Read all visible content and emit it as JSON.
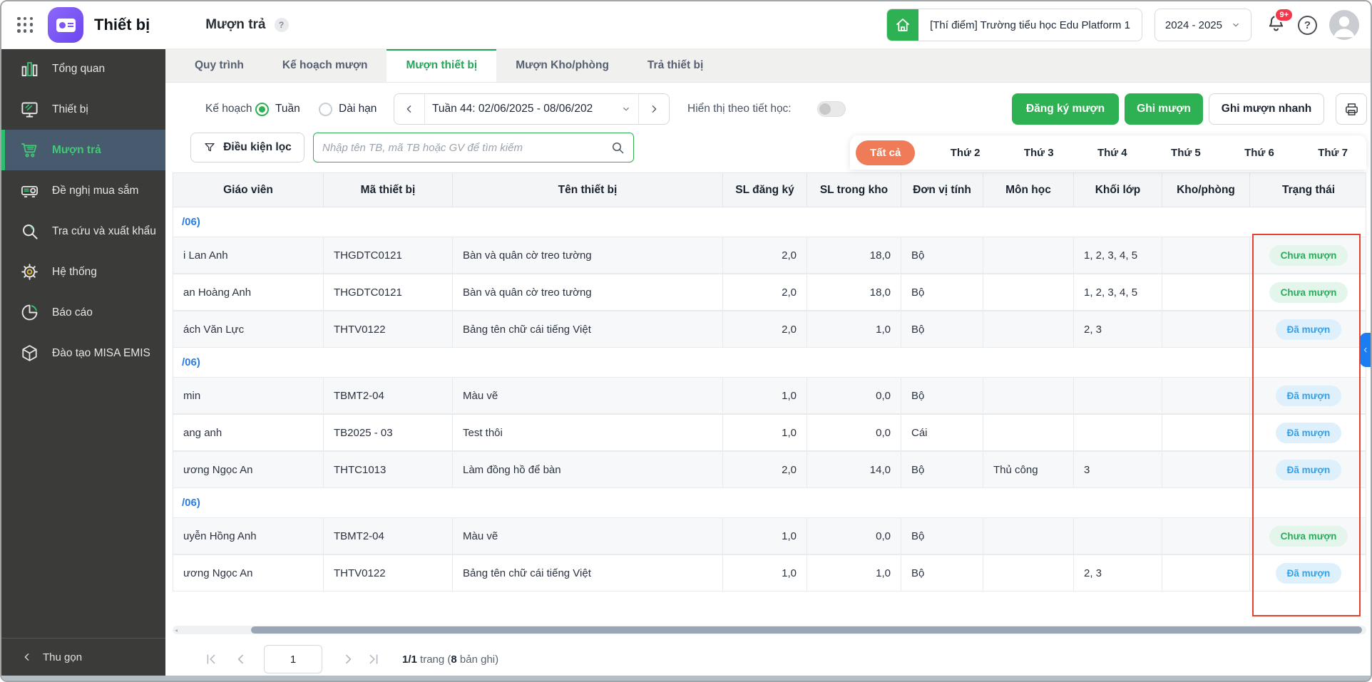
{
  "header": {
    "app_name": "Thiết bị",
    "page_title": "Mượn trả",
    "help_badge": "?",
    "school": "[Thí điểm] Trường tiểu học Edu Platform 1",
    "school_year": "2024 - 2025",
    "notification_count": "9+"
  },
  "sidebar": {
    "items": [
      {
        "id": "tong-quan",
        "label": "Tổng quan",
        "icon": "bar-chart-icon",
        "active": false
      },
      {
        "id": "thiet-bi",
        "label": "Thiết bị",
        "icon": "monitor-icon",
        "active": false
      },
      {
        "id": "muon-tra",
        "label": "Mượn trả",
        "icon": "cart-icon",
        "active": true
      },
      {
        "id": "de-nghi-mua-sam",
        "label": "Đề nghị mua sắm",
        "icon": "projector-icon",
        "active": false
      },
      {
        "id": "tra-cuu-va-xuat-khau",
        "label": "Tra cứu và xuất khẩu",
        "icon": "search-icon",
        "active": false
      },
      {
        "id": "he-thong",
        "label": "Hệ thống",
        "icon": "gear-icon",
        "active": false
      },
      {
        "id": "bao-cao",
        "label": "Báo cáo",
        "icon": "pie-chart-icon",
        "active": false
      },
      {
        "id": "dao-tao-misa-emis",
        "label": "Đào tạo MISA EMIS",
        "icon": "cube-icon",
        "active": false
      }
    ],
    "collapse_label": "Thu gọn"
  },
  "tabs": {
    "active_index": 2,
    "items": [
      {
        "id": "quy-trinh",
        "label": "Quy trình"
      },
      {
        "id": "ke-hoach-muon",
        "label": "Kế hoạch mượn"
      },
      {
        "id": "muon-thiet-bi",
        "label": "Mượn thiết bị"
      },
      {
        "id": "muon-kho-phong",
        "label": "Mượn Kho/phòng"
      },
      {
        "id": "tra-thiet-bi",
        "label": "Trả thiết bị"
      }
    ]
  },
  "controls": {
    "plan_label": "Kế hoạch",
    "radio_week": "Tuần",
    "radio_longterm": "Dài hạn",
    "week_selector": "Tuần 44: 02/06/2025 - 08/06/202",
    "toggle_label": "Hiển thị theo tiết học:",
    "toggle_state": "off",
    "register_button": "Đăng ký mượn",
    "record_button": "Ghi mượn",
    "quick_record_button": "Ghi mượn nhanh"
  },
  "filter": {
    "filter_button": "Điều kiện lọc",
    "search_placeholder": "Nhập tên TB, mã TB hoặc GV để tìm kiếm",
    "search_value": ""
  },
  "day_tabs": {
    "active_index": 0,
    "items": [
      {
        "id": "tat-ca",
        "label": "Tất cả"
      },
      {
        "id": "thu-2",
        "label": "Thứ 2"
      },
      {
        "id": "thu-3",
        "label": "Thứ 3"
      },
      {
        "id": "thu-4",
        "label": "Thứ 4"
      },
      {
        "id": "thu-5",
        "label": "Thứ 5"
      },
      {
        "id": "thu-6",
        "label": "Thứ 6"
      },
      {
        "id": "thu-7",
        "label": "Thứ 7"
      }
    ]
  },
  "table": {
    "columns": [
      "Giáo viên",
      "Mã thiết bị",
      "Tên thiết bị",
      "SL đăng ký",
      "SL trong kho",
      "Đơn vị tính",
      "Môn học",
      "Khối lớp",
      "Kho/phòng",
      "Trạng thái"
    ],
    "groups": [
      {
        "label": "/06)",
        "rows": [
          {
            "teacher": "i Lan Anh",
            "code": "THGDTC0121",
            "name": "Bàn và quân cờ treo tường",
            "qty": "2,0",
            "stock": "18,0",
            "unit": "Bộ",
            "subject": "",
            "grades": "1, 2, 3, 4, 5",
            "room": "",
            "status": "Chưa mượn",
            "status_type": "not_borrowed"
          },
          {
            "teacher": "an Hoàng Anh",
            "code": "THGDTC0121",
            "name": "Bàn và quân cờ treo tường",
            "qty": "2,0",
            "stock": "18,0",
            "unit": "Bộ",
            "subject": "",
            "grades": "1, 2, 3, 4, 5",
            "room": "",
            "status": "Chưa mượn",
            "status_type": "not_borrowed"
          },
          {
            "teacher": "ách Văn Lực",
            "code": "THTV0122",
            "name": "Bảng tên chữ cái tiếng Việt",
            "qty": "2,0",
            "stock": "1,0",
            "unit": "Bộ",
            "subject": "",
            "grades": "2, 3",
            "room": "",
            "status": "Đã mượn",
            "status_type": "borrowed"
          }
        ]
      },
      {
        "label": "/06)",
        "rows": [
          {
            "teacher": "min",
            "code": "TBMT2-04",
            "name": "Màu vẽ",
            "qty": "1,0",
            "stock": "0,0",
            "unit": "Bộ",
            "subject": "",
            "grades": "",
            "room": "",
            "status": "Đã mượn",
            "status_type": "borrowed"
          },
          {
            "teacher": "ang anh",
            "code": "TB2025 - 03",
            "name": "Test thôi",
            "qty": "1,0",
            "stock": "0,0",
            "unit": "Cái",
            "subject": "",
            "grades": "",
            "room": "",
            "status": "Đã mượn",
            "status_type": "borrowed"
          },
          {
            "teacher": "ương Ngọc An",
            "code": "THTC1013",
            "name": "Làm đồng hồ để bàn",
            "qty": "2,0",
            "stock": "14,0",
            "unit": "Bộ",
            "subject": "Thủ công",
            "grades": "3",
            "room": "",
            "status": "Đã mượn",
            "status_type": "borrowed"
          }
        ]
      },
      {
        "label": "/06)",
        "rows": [
          {
            "teacher": "uyễn Hồng Anh",
            "code": "TBMT2-04",
            "name": "Màu vẽ",
            "qty": "1,0",
            "stock": "0,0",
            "unit": "Bộ",
            "subject": "",
            "grades": "",
            "room": "",
            "status": "Chưa mượn",
            "status_type": "not_borrowed"
          },
          {
            "teacher": "ương Ngọc An",
            "code": "THTV0122",
            "name": "Bảng tên chữ cái tiếng Việt",
            "qty": "1,0",
            "stock": "1,0",
            "unit": "Bộ",
            "subject": "",
            "grades": "2, 3",
            "room": "",
            "status": "Đã mượn",
            "status_type": "borrowed"
          }
        ]
      }
    ]
  },
  "pagination": {
    "page_value": "1",
    "info_pages_bold": "1/1",
    "info_mid": " trang (",
    "info_count_bold": "8",
    "info_suffix": " bản ghi)"
  },
  "colors": {
    "accent_green": "#2db152",
    "sidebar_active_bar": "#2dbd6e",
    "day_tab_active": "#ef7b58",
    "status_not_borrowed_bg": "#e4f6ec",
    "status_not_borrowed_text": "#2bab5c",
    "status_borrowed_bg": "#def0fb",
    "status_borrowed_text": "#36a0e8",
    "highlight_rect": "#e8402a",
    "side_flap_blue": "#1c7cf2",
    "group_link_blue": "#2c7de0"
  }
}
